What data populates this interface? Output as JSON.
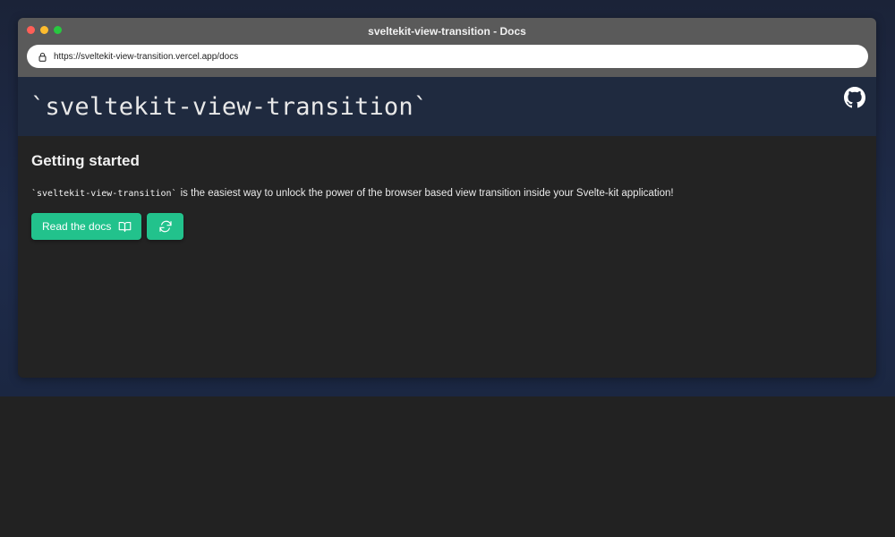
{
  "window": {
    "title": "sveltekit-view-transition - Docs",
    "traffic_lights": [
      "#ff5f57",
      "#febc2e",
      "#28c840"
    ]
  },
  "urlbar": {
    "url": "https://sveltekit-view-transition.vercel.app/docs",
    "lock_icon": "lock-icon"
  },
  "header": {
    "site_title": "`sveltekit-view-transition`",
    "github_icon": "github-icon",
    "background": "#1f2a3f"
  },
  "main": {
    "heading": "Getting started",
    "description_code": "`sveltekit-view-transition`",
    "description_text": "is the easiest way to unlock the power of the browser based view transition inside your Svelte-kit application!",
    "buttons": {
      "docs_label": "Read the docs",
      "docs_icon": "book-open-icon",
      "refresh_icon": "refresh-icon"
    },
    "accent": "#22c28c"
  }
}
